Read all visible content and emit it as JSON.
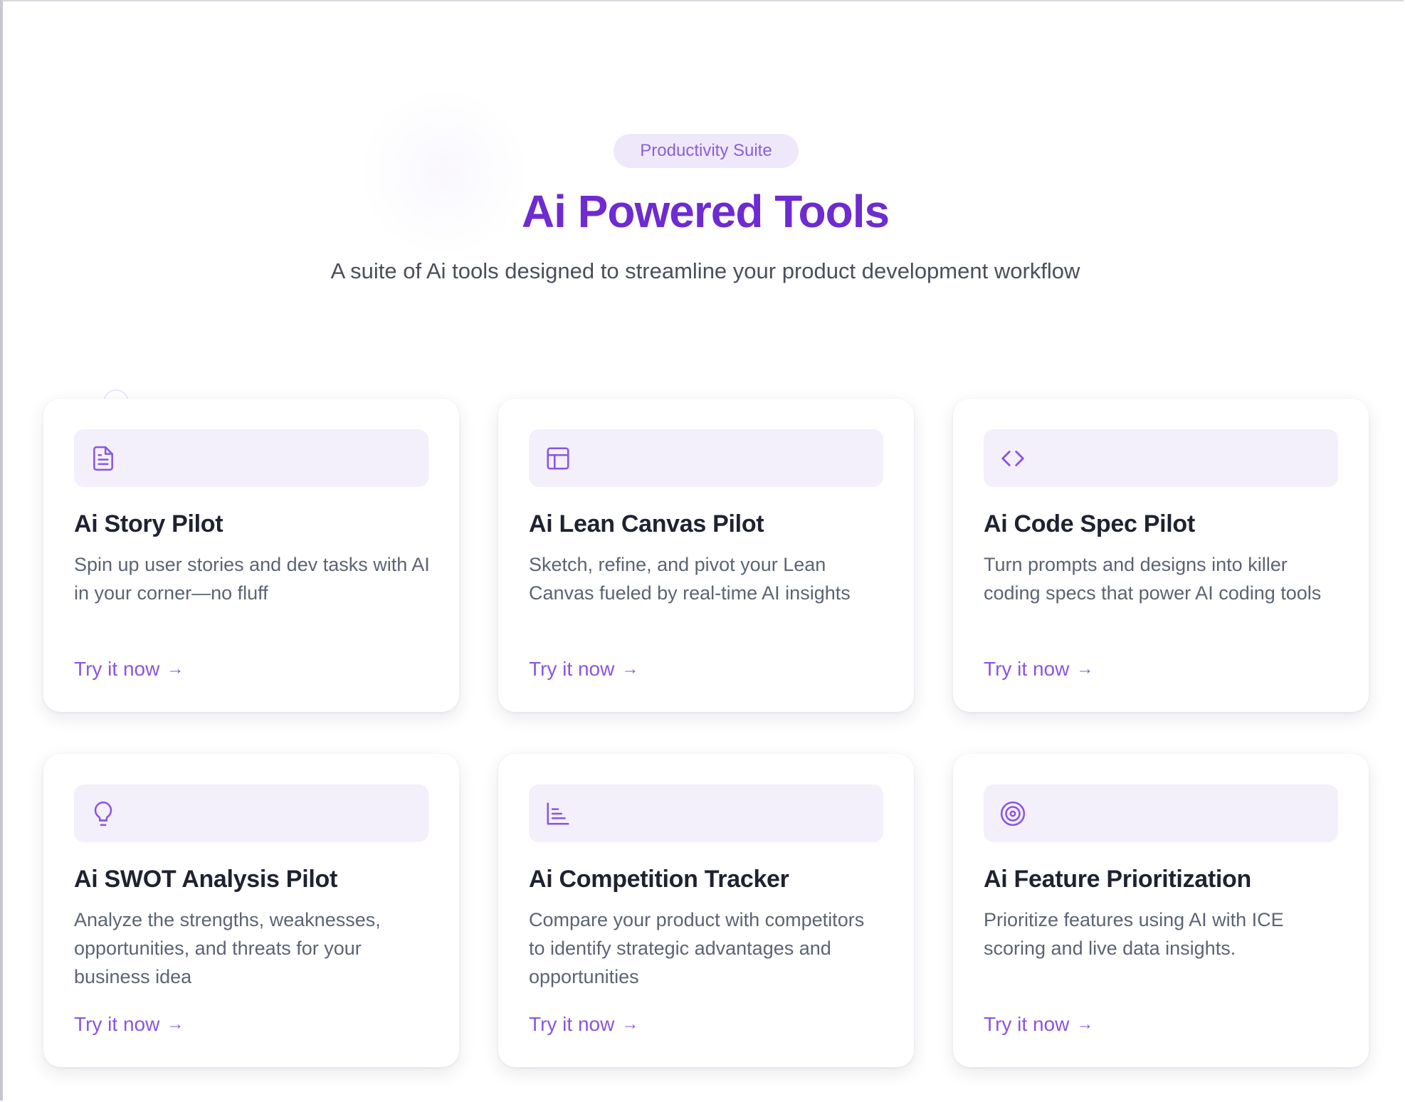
{
  "hero": {
    "badge": "Productivity Suite",
    "title": "Ai Powered Tools",
    "subtitle": "A suite of Ai tools designed to streamline your product development workflow"
  },
  "colors": {
    "accent": "#6d2bd1",
    "link": "#8a55e0",
    "icon_bg": "#f3effb",
    "badge_bg": "#efe8fb"
  },
  "cards": [
    {
      "icon": "document-icon",
      "title": "Ai Story Pilot",
      "description": "Spin up user stories and dev tasks with AI in your corner—no fluff",
      "cta": "Try it now"
    },
    {
      "icon": "layout-icon",
      "title": "Ai Lean Canvas Pilot",
      "description": "Sketch, refine, and pivot your Lean Canvas fueled by real-time AI insights",
      "cta": "Try it now"
    },
    {
      "icon": "code-icon",
      "title": "Ai Code Spec Pilot",
      "description": "Turn prompts and designs into killer coding specs that power AI coding tools",
      "cta": "Try it now"
    },
    {
      "icon": "lightbulb-icon",
      "title": "Ai SWOT Analysis Pilot",
      "description": "Analyze the strengths, weaknesses, opportunities, and threats for your business idea",
      "cta": "Try it now"
    },
    {
      "icon": "bar-chart-icon",
      "title": "Ai Competition Tracker",
      "description": "Compare your product with competitors to identify strategic advantages and opportunities",
      "cta": "Try it now"
    },
    {
      "icon": "target-icon",
      "title": "Ai Feature Prioritization",
      "description": "Prioritize features using AI with ICE scoring and live data insights.",
      "cta": "Try it now"
    }
  ]
}
